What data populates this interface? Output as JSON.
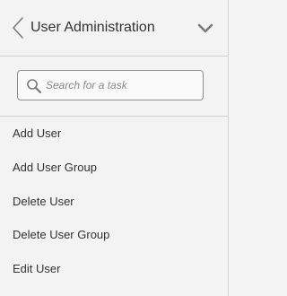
{
  "header": {
    "title": "User Administration",
    "back_icon": "back-chevron-icon",
    "expand_icon": "chevron-down-icon"
  },
  "search": {
    "placeholder": "Search for a task",
    "value": "",
    "icon": "search-icon"
  },
  "menu": {
    "items": [
      {
        "label": "Add User"
      },
      {
        "label": "Add User Group"
      },
      {
        "label": "Delete User"
      },
      {
        "label": "Delete User Group"
      },
      {
        "label": "Edit User"
      }
    ]
  },
  "colors": {
    "background": "#f3f3f3",
    "divider": "#cfcfcf",
    "text": "#333333",
    "placeholder": "#8a8a8a",
    "icon": "#7a7a7a"
  }
}
